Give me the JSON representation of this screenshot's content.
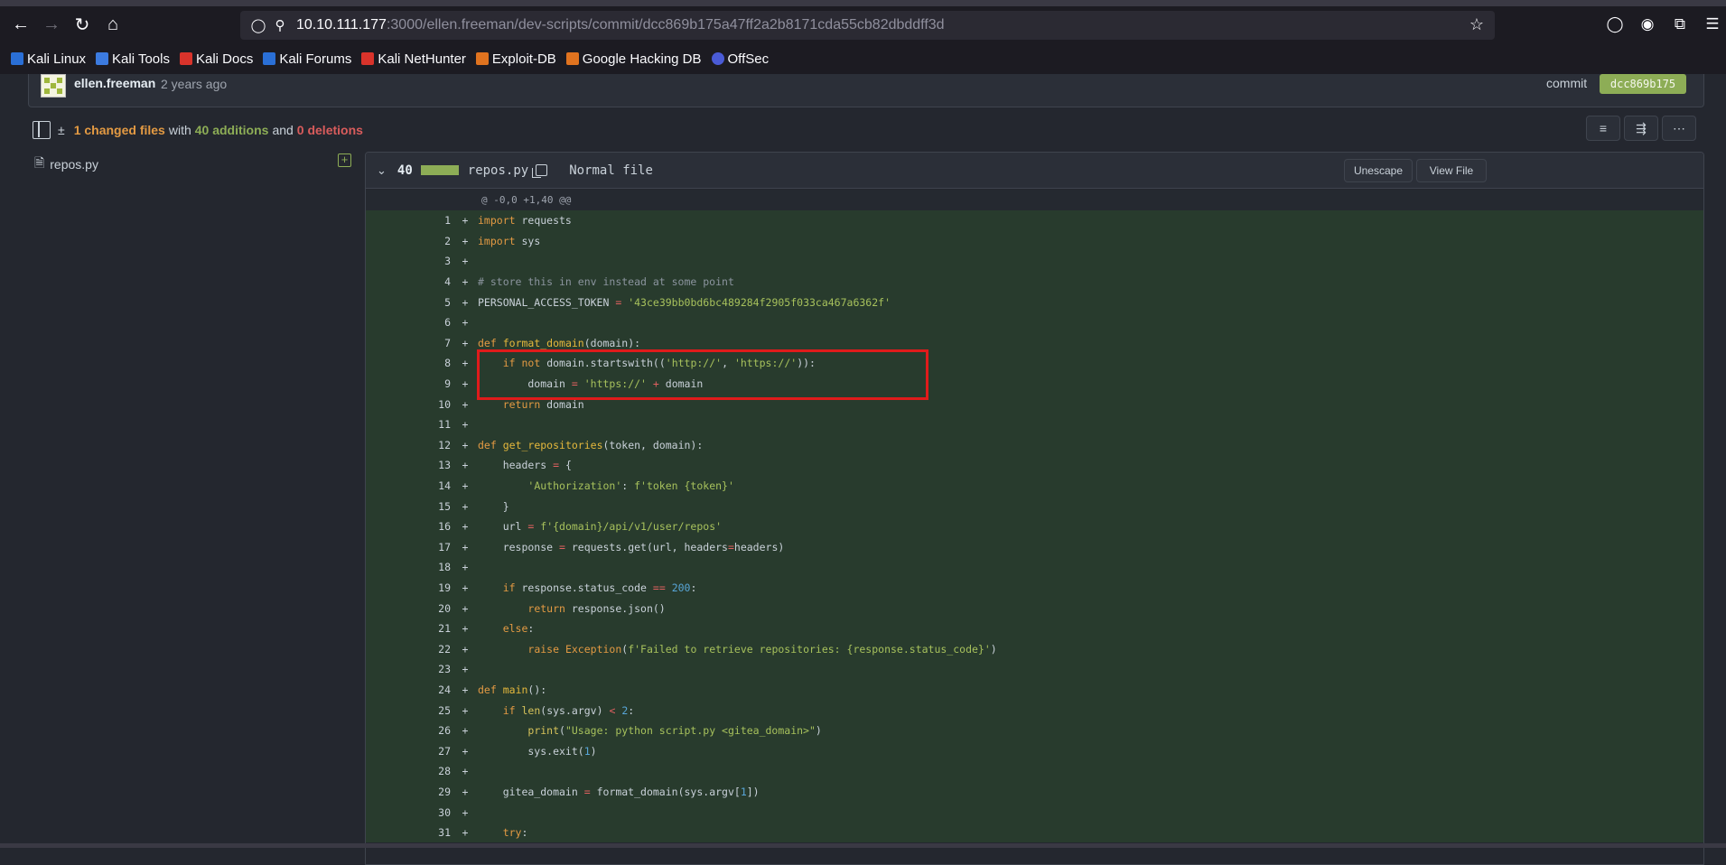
{
  "browser": {
    "url_host": "10.10.111.177",
    "url_path": ":3000/ellen.freeman/dev-scripts/commit/dcc869b175a47ff2a2b8171cda55cb82dbddff3d",
    "bookmarks": [
      "Kali Linux",
      "Kali Tools",
      "Kali Docs",
      "Kali Forums",
      "Kali NetHunter",
      "Exploit-DB",
      "Google Hacking DB",
      "OffSec"
    ]
  },
  "commit": {
    "author": "ellen.freeman",
    "time": "2 years ago",
    "label": "commit",
    "sha": "dcc869b175"
  },
  "stats": {
    "changed": "1 changed files",
    "with": "with",
    "additions": "40 additions",
    "and": "and",
    "deletions": "0 deletions"
  },
  "tree": {
    "file": "repos.py"
  },
  "diff": {
    "count": "40",
    "filename": "repos.py",
    "mode": "Normal file",
    "unescape": "Unescape",
    "view_file": "View File",
    "hunk": "@ -0,0 +1,40 @@"
  },
  "code_lines": [
    {
      "n": "1",
      "t": "import requests"
    },
    {
      "n": "2",
      "t": "import sys"
    },
    {
      "n": "3",
      "t": ""
    },
    {
      "n": "4",
      "t": "# store this in env instead at some point"
    },
    {
      "n": "5",
      "t": "PERSONAL_ACCESS_TOKEN = '43ce39bb0bd6bc489284f2905f033ca467a6362f'"
    },
    {
      "n": "6",
      "t": ""
    },
    {
      "n": "7",
      "t": "def format_domain(domain):"
    },
    {
      "n": "8",
      "t": "    if not domain.startswith(('http://', 'https://')):"
    },
    {
      "n": "9",
      "t": "        domain = 'https://' + domain"
    },
    {
      "n": "10",
      "t": "    return domain"
    },
    {
      "n": "11",
      "t": ""
    },
    {
      "n": "12",
      "t": "def get_repositories(token, domain):"
    },
    {
      "n": "13",
      "t": "    headers = {"
    },
    {
      "n": "14",
      "t": "        'Authorization': f'token {token}'"
    },
    {
      "n": "15",
      "t": "    }"
    },
    {
      "n": "16",
      "t": "    url = f'{domain}/api/v1/user/repos'"
    },
    {
      "n": "17",
      "t": "    response = requests.get(url, headers=headers)"
    },
    {
      "n": "18",
      "t": ""
    },
    {
      "n": "19",
      "t": "    if response.status_code == 200:"
    },
    {
      "n": "20",
      "t": "        return response.json()"
    },
    {
      "n": "21",
      "t": "    else:"
    },
    {
      "n": "22",
      "t": "        raise Exception(f'Failed to retrieve repositories: {response.status_code}')"
    },
    {
      "n": "23",
      "t": ""
    },
    {
      "n": "24",
      "t": "def main():"
    },
    {
      "n": "25",
      "t": "    if len(sys.argv) < 2:"
    },
    {
      "n": "26",
      "t": "        print(\"Usage: python script.py <gitea_domain>\")"
    },
    {
      "n": "27",
      "t": "        sys.exit(1)"
    },
    {
      "n": "28",
      "t": ""
    },
    {
      "n": "29",
      "t": "    gitea_domain = format_domain(sys.argv[1])"
    },
    {
      "n": "30",
      "t": ""
    },
    {
      "n": "31",
      "t": "    try:"
    }
  ]
}
